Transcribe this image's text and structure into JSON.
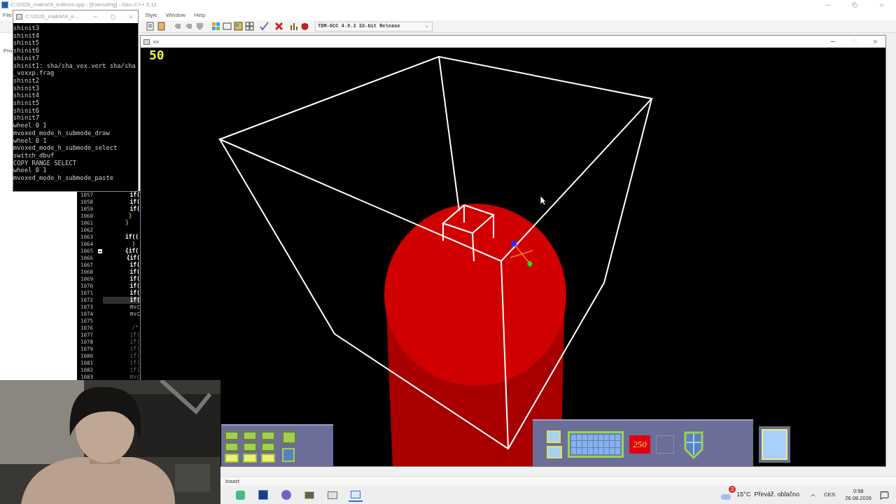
{
  "ide": {
    "title": "C:\\2026_matrix\\9_editvox.cpp - [Executing] - Dev-C++ 5.11",
    "menu": [
      "File",
      "Style",
      "Window",
      "Help"
    ],
    "compiler": "TDM-GCC 4.9.2 32-bit Release",
    "side_tab": "Pro",
    "code_lines": [
      {
        "number": "1057",
        "code": "        if(",
        "kind": "keyword",
        "selected": false,
        "fold": false
      },
      {
        "number": "1058",
        "code": "        if(",
        "kind": "keyword",
        "selected": false,
        "fold": false
      },
      {
        "number": "1059",
        "code": "        if(",
        "kind": "keyword",
        "selected": false,
        "fold": false
      },
      {
        "number": "1060",
        "code": "       }",
        "kind": "brace",
        "selected": false,
        "fold": false
      },
      {
        "number": "1061",
        "code": "      }",
        "kind": "brace",
        "selected": false,
        "fold": false
      },
      {
        "number": "1062",
        "kind": "plain",
        "selected": false,
        "fold": false
      },
      {
        "number": "1063",
        "code": "      if((",
        "kind": "keyword",
        "selected": false,
        "fold": false
      },
      {
        "number": "1064",
        "code": "        )",
        "kind": "brace",
        "selected": false,
        "fold": false
      },
      {
        "number": "1065",
        "code": "      {if(",
        "kind": "keyword",
        "selected": false,
        "fold": true
      },
      {
        "number": "1066",
        "code": "       {if(",
        "kind": "keyword",
        "selected": false,
        "fold": false
      },
      {
        "number": "1067",
        "code": "        if(",
        "kind": "keyword",
        "selected": false,
        "fold": false
      },
      {
        "number": "1068",
        "code": "        if(",
        "kind": "keyword",
        "selected": false,
        "fold": false
      },
      {
        "number": "1069",
        "code": "        if(",
        "kind": "keyword",
        "selected": false,
        "fold": false
      },
      {
        "number": "1070",
        "code": "        if(",
        "kind": "keyword",
        "selected": false,
        "fold": false
      },
      {
        "number": "1071",
        "code": "        if(",
        "kind": "keyword",
        "selected": false,
        "fold": false
      },
      {
        "number": "1072",
        "code": "        if(",
        "kind": "keyword",
        "selected": true,
        "fold": false
      },
      {
        "number": "1073",
        "code": "        mvc",
        "kind": "plain",
        "selected": false,
        "fold": false
      },
      {
        "number": "1074",
        "code": "        mvc",
        "kind": "plain",
        "selected": false,
        "fold": false
      },
      {
        "number": "1075",
        "kind": "plain",
        "selected": false,
        "fold": false
      },
      {
        "number": "1076",
        "code": "        /*",
        "kind": "comment",
        "selected": false,
        "fold": false
      },
      {
        "number": "1077",
        "code": "        if(",
        "kind": "comment",
        "selected": false,
        "fold": false
      },
      {
        "number": "1078",
        "code": "        if(",
        "kind": "comment",
        "selected": false,
        "fold": false
      },
      {
        "number": "1079",
        "code": "        if(",
        "kind": "comment",
        "selected": false,
        "fold": false
      },
      {
        "number": "1080",
        "code": "        if(",
        "kind": "comment",
        "selected": false,
        "fold": false
      },
      {
        "number": "1081",
        "code": "        if(",
        "kind": "comment",
        "selected": false,
        "fold": false
      },
      {
        "number": "1082",
        "code": "        if(",
        "kind": "comment",
        "selected": false,
        "fold": false
      },
      {
        "number": "1083",
        "code": "        mvc",
        "kind": "comment",
        "selected": false,
        "fold": false
      }
    ],
    "status": "Insert"
  },
  "console": {
    "title": "C:\\2026_matrix\\9_e...",
    "lines": [
      "shinit3",
      "shinit4",
      "shinit5",
      "shinit6",
      "shinit7",
      "shinit1: sha/sha_vox.vert sha/sha",
      "_voxxp.frag",
      "shinit2",
      "shinit3",
      "shinit4",
      "shinit5",
      "shinit6",
      "shinit7",
      "wheel 0 1",
      "mvoxed_mode_h_submode_draw",
      "wheel 0 1",
      "mvoxed_mode_h_submode_select",
      "switch_dbuf",
      "COPY RANGE SELECT",
      "wheel 0 1",
      "mvoxed_mode_h_submode_paste"
    ]
  },
  "game": {
    "title": "xx",
    "fps": "50",
    "counter": "250"
  },
  "taskbar": {
    "weather_badge": "2",
    "temperature": "15°C",
    "weather": "Převáž. oblačno",
    "language": "CES",
    "time": "0:58",
    "date": "26.08.2026"
  }
}
